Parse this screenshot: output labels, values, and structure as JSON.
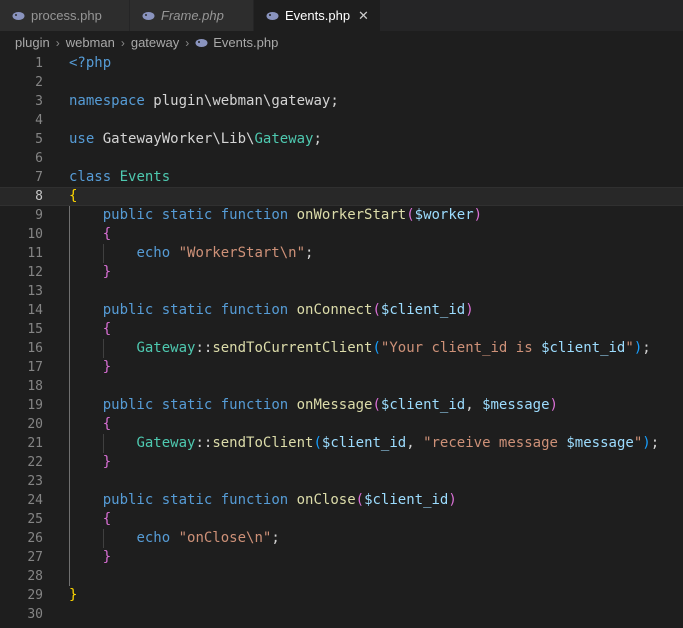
{
  "tabs": [
    {
      "label": "process.php",
      "icon": "php-elephant-icon",
      "italic": false,
      "active": false
    },
    {
      "label": "Frame.php",
      "icon": "php-elephant-icon",
      "italic": true,
      "active": false
    },
    {
      "label": "Events.php",
      "icon": "php-elephant-icon",
      "italic": false,
      "active": true,
      "close": "✕"
    }
  ],
  "breadcrumb": {
    "items": [
      "plugin",
      "webman",
      "gateway",
      "Events.php"
    ],
    "separator": "›"
  },
  "editor": {
    "current_line": 8,
    "lines": [
      "<?php",
      "",
      "namespace plugin\\webman\\gateway;",
      "",
      "use GatewayWorker\\Lib\\Gateway;",
      "",
      "class Events",
      "{",
      "    public static function onWorkerStart($worker)",
      "    {",
      "        echo \"WorkerStart\\n\";",
      "    }",
      "",
      "    public static function onConnect($client_id)",
      "    {",
      "        Gateway::sendToCurrentClient(\"Your client_id is $client_id\");",
      "    }",
      "",
      "    public static function onMessage($client_id, $message)",
      "    {",
      "        Gateway::sendToClient($client_id, \"receive message $message\");",
      "    }",
      "",
      "    public static function onClose($client_id)",
      "    {",
      "        echo \"onClose\\n\";",
      "    }",
      "",
      "}",
      ""
    ],
    "line_numbers": [
      "1",
      "2",
      "3",
      "4",
      "5",
      "6",
      "7",
      "8",
      "9",
      "10",
      "11",
      "12",
      "13",
      "14",
      "15",
      "16",
      "17",
      "18",
      "19",
      "20",
      "21",
      "22",
      "23",
      "24",
      "25",
      "26",
      "27",
      "28",
      "29",
      "30"
    ]
  },
  "colors": {
    "background": "#1e1e1e",
    "keyword": "#569cd6",
    "function": "#dcdcaa",
    "string": "#ce9178",
    "variable": "#9cdcfe",
    "class": "#4ec9b0",
    "bracket_gold": "#ffd700",
    "bracket_purple": "#da70d6"
  }
}
